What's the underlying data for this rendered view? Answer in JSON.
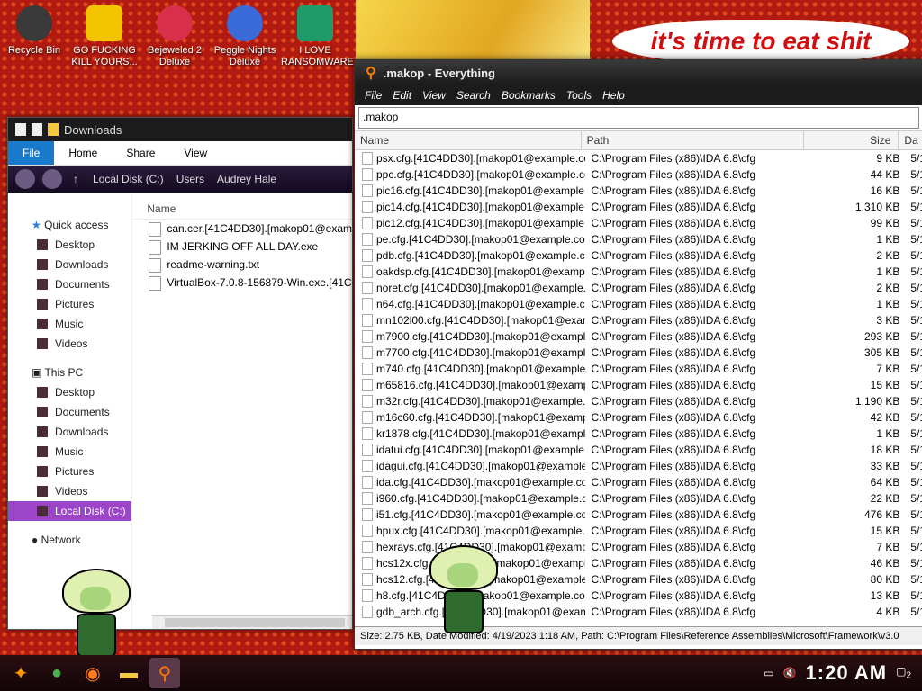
{
  "desktop": {
    "banner": "it's time to eat shit",
    "icons": [
      {
        "label": "Recycle Bin"
      },
      {
        "label": "GO FUCKING KILL YOURS..."
      },
      {
        "label": "Bejeweled 2 Deluxe"
      },
      {
        "label": "Peggle Nights Deluxe"
      },
      {
        "label": "I LOVE RANSOMWARE"
      }
    ]
  },
  "explorer": {
    "title": "Downloads",
    "ribbon": [
      "File",
      "Home",
      "Share",
      "View"
    ],
    "breadcrumb": [
      "Local Disk (C:)",
      "Users",
      "Audrey Hale"
    ],
    "quick_access": "Quick access",
    "quick_items": [
      "Desktop",
      "Downloads",
      "Documents",
      "Pictures",
      "Music",
      "Videos"
    ],
    "this_pc": "This PC",
    "pc_items": [
      "Desktop",
      "Documents",
      "Downloads",
      "Music",
      "Pictures",
      "Videos",
      "Local Disk (C:)"
    ],
    "network": "Network",
    "column_name": "Name",
    "files": [
      "can.cer.[41C4DD30].[makop01@exam",
      "IM JERKING OFF ALL DAY.exe",
      "readme-warning.txt",
      "VirtualBox-7.0.8-156879-Win.exe.[41C"
    ]
  },
  "everything": {
    "title": ".makop - Everything",
    "menu": [
      "File",
      "Edit",
      "View",
      "Search",
      "Bookmarks",
      "Tools",
      "Help"
    ],
    "search_value": ".makop",
    "columns": [
      "Name",
      "Path",
      "Size",
      "Da"
    ],
    "rows": [
      {
        "name": "psx.cfg.[41C4DD30].[makop01@example.co...",
        "path": "C:\\Program Files (x86)\\IDA 6.8\\cfg",
        "size": "9 KB",
        "date": "5/1"
      },
      {
        "name": "ppc.cfg.[41C4DD30].[makop01@example.co...",
        "path": "C:\\Program Files (x86)\\IDA 6.8\\cfg",
        "size": "44 KB",
        "date": "5/1"
      },
      {
        "name": "pic16.cfg.[41C4DD30].[makop01@example.c...",
        "path": "C:\\Program Files (x86)\\IDA 6.8\\cfg",
        "size": "16 KB",
        "date": "5/1"
      },
      {
        "name": "pic14.cfg.[41C4DD30].[makop01@example.c...",
        "path": "C:\\Program Files (x86)\\IDA 6.8\\cfg",
        "size": "1,310 KB",
        "date": "5/1"
      },
      {
        "name": "pic12.cfg.[41C4DD30].[makop01@example.c...",
        "path": "C:\\Program Files (x86)\\IDA 6.8\\cfg",
        "size": "99 KB",
        "date": "5/1"
      },
      {
        "name": "pe.cfg.[41C4DD30].[makop01@example.com...",
        "path": "C:\\Program Files (x86)\\IDA 6.8\\cfg",
        "size": "1 KB",
        "date": "5/1"
      },
      {
        "name": "pdb.cfg.[41C4DD30].[makop01@example.co...",
        "path": "C:\\Program Files (x86)\\IDA 6.8\\cfg",
        "size": "2 KB",
        "date": "5/1"
      },
      {
        "name": "oakdsp.cfg.[41C4DD30].[makop01@example...",
        "path": "C:\\Program Files (x86)\\IDA 6.8\\cfg",
        "size": "1 KB",
        "date": "5/1"
      },
      {
        "name": "noret.cfg.[41C4DD30].[makop01@example.c...",
        "path": "C:\\Program Files (x86)\\IDA 6.8\\cfg",
        "size": "2 KB",
        "date": "5/1"
      },
      {
        "name": "n64.cfg.[41C4DD30].[makop01@example.co...",
        "path": "C:\\Program Files (x86)\\IDA 6.8\\cfg",
        "size": "1 KB",
        "date": "5/1"
      },
      {
        "name": "mn102l00.cfg.[41C4DD30].[makop01@exam...",
        "path": "C:\\Program Files (x86)\\IDA 6.8\\cfg",
        "size": "3 KB",
        "date": "5/1"
      },
      {
        "name": "m7900.cfg.[41C4DD30].[makop01@example....",
        "path": "C:\\Program Files (x86)\\IDA 6.8\\cfg",
        "size": "293 KB",
        "date": "5/1"
      },
      {
        "name": "m7700.cfg.[41C4DD30].[makop01@example....",
        "path": "C:\\Program Files (x86)\\IDA 6.8\\cfg",
        "size": "305 KB",
        "date": "5/1"
      },
      {
        "name": "m740.cfg.[41C4DD30].[makop01@example.c...",
        "path": "C:\\Program Files (x86)\\IDA 6.8\\cfg",
        "size": "7 KB",
        "date": "5/1"
      },
      {
        "name": "m65816.cfg.[41C4DD30].[makop01@exampl...",
        "path": "C:\\Program Files (x86)\\IDA 6.8\\cfg",
        "size": "15 KB",
        "date": "5/1"
      },
      {
        "name": "m32r.cfg.[41C4DD30].[makop01@example.c...",
        "path": "C:\\Program Files (x86)\\IDA 6.8\\cfg",
        "size": "1,190 KB",
        "date": "5/1"
      },
      {
        "name": "m16c60.cfg.[41C4DD30].[makop01@example...",
        "path": "C:\\Program Files (x86)\\IDA 6.8\\cfg",
        "size": "42 KB",
        "date": "5/1"
      },
      {
        "name": "kr1878.cfg.[41C4DD30].[makop01@example...",
        "path": "C:\\Program Files (x86)\\IDA 6.8\\cfg",
        "size": "1 KB",
        "date": "5/1"
      },
      {
        "name": "idatui.cfg.[41C4DD30].[makop01@example.c...",
        "path": "C:\\Program Files (x86)\\IDA 6.8\\cfg",
        "size": "18 KB",
        "date": "5/1"
      },
      {
        "name": "idagui.cfg.[41C4DD30].[makop01@example.c...",
        "path": "C:\\Program Files (x86)\\IDA 6.8\\cfg",
        "size": "33 KB",
        "date": "5/1"
      },
      {
        "name": "ida.cfg.[41C4DD30].[makop01@example.com...",
        "path": "C:\\Program Files (x86)\\IDA 6.8\\cfg",
        "size": "64 KB",
        "date": "5/1"
      },
      {
        "name": "i960.cfg.[41C4DD30].[makop01@example.co...",
        "path": "C:\\Program Files (x86)\\IDA 6.8\\cfg",
        "size": "22 KB",
        "date": "5/1"
      },
      {
        "name": "i51.cfg.[41C4DD30].[makop01@example.com...",
        "path": "C:\\Program Files (x86)\\IDA 6.8\\cfg",
        "size": "476 KB",
        "date": "5/1"
      },
      {
        "name": "hpux.cfg.[41C4DD30].[makop01@example.co...",
        "path": "C:\\Program Files (x86)\\IDA 6.8\\cfg",
        "size": "15 KB",
        "date": "5/1"
      },
      {
        "name": "hexrays.cfg.[41C4DD30].[makop01@exampl...",
        "path": "C:\\Program Files (x86)\\IDA 6.8\\cfg",
        "size": "7 KB",
        "date": "5/1"
      },
      {
        "name": "hcs12x.cfg.[41C4DD30].[makop01@example...",
        "path": "C:\\Program Files (x86)\\IDA 6.8\\cfg",
        "size": "46 KB",
        "date": "5/1"
      },
      {
        "name": "hcs12.cfg.[41C4DD30].[makop01@example.c...",
        "path": "C:\\Program Files (x86)\\IDA 6.8\\cfg",
        "size": "80 KB",
        "date": "5/1"
      },
      {
        "name": "h8.cfg.[41C4DD30].[makop01@example.com...",
        "path": "C:\\Program Files (x86)\\IDA 6.8\\cfg",
        "size": "13 KB",
        "date": "5/1"
      },
      {
        "name": "gdb_arch.cfg.[41C4DD30].[makop01@examp...",
        "path": "C:\\Program Files (x86)\\IDA 6.8\\cfg",
        "size": "4 KB",
        "date": "5/1"
      }
    ],
    "status": "Size: 2.75 KB, Date Modified: 4/19/2023 1:18 AM, Path: C:\\Program Files\\Reference Assemblies\\Microsoft\\Framework\\v3.0"
  },
  "taskbar": {
    "clock": "1:20 AM",
    "notification_count": "2",
    "icons": [
      "start-icon",
      "chrome-icon",
      "firefox-icon",
      "file-explorer-icon",
      "everything-search-icon"
    ]
  }
}
